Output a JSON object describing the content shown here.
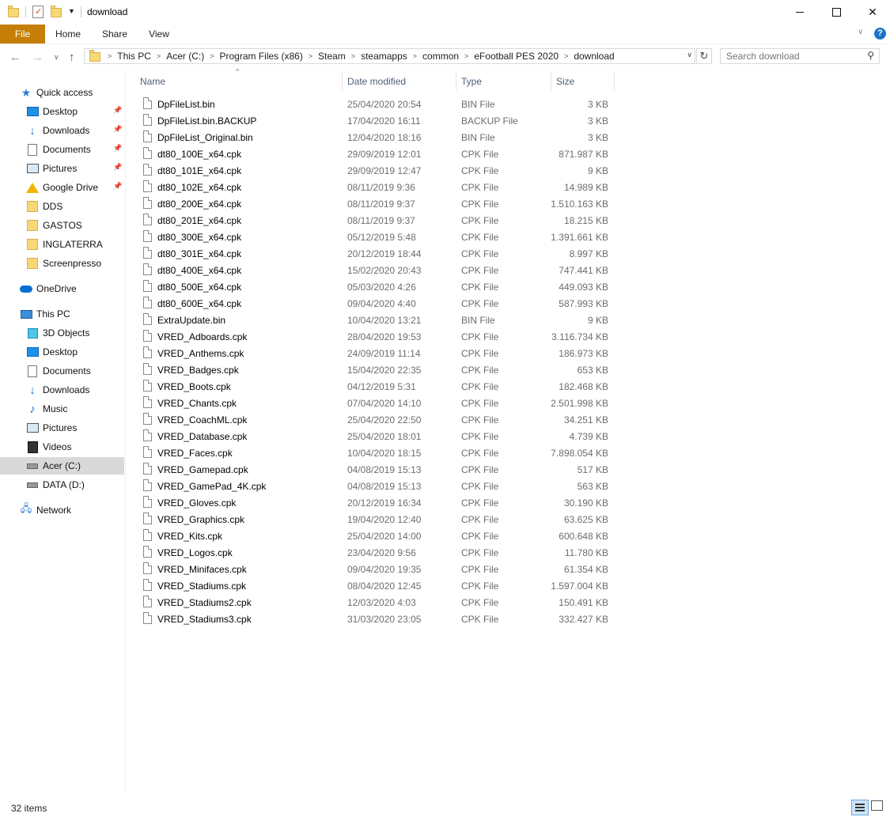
{
  "window": {
    "title": "download",
    "minimize_icon": "minimize-icon",
    "maximize_icon": "maximize-icon",
    "close_icon": "close-icon"
  },
  "ribbon": {
    "tabs": [
      "File",
      "Home",
      "Share",
      "View"
    ],
    "file_tab_color": "#c57e07",
    "help_label": "?"
  },
  "address": {
    "breadcrumbs": [
      "This PC",
      "Acer (C:)",
      "Program Files (x86)",
      "Steam",
      "steamapps",
      "common",
      "eFootball PES 2020",
      "download"
    ]
  },
  "search": {
    "placeholder": "Search download"
  },
  "sidebar": {
    "items": [
      {
        "label": "Quick access",
        "icon": "star-icon",
        "pinned": false,
        "indent": 0
      },
      {
        "label": "Desktop",
        "icon": "desktop-icon",
        "pinned": true,
        "indent": 1
      },
      {
        "label": "Downloads",
        "icon": "downloads-icon",
        "pinned": true,
        "indent": 1
      },
      {
        "label": "Documents",
        "icon": "documents-icon",
        "pinned": true,
        "indent": 1
      },
      {
        "label": "Pictures",
        "icon": "pictures-icon",
        "pinned": true,
        "indent": 1
      },
      {
        "label": "Google Drive",
        "icon": "google-drive-icon",
        "pinned": true,
        "indent": 1
      },
      {
        "label": "DDS",
        "icon": "folder-icon",
        "pinned": false,
        "indent": 1
      },
      {
        "label": "GASTOS",
        "icon": "folder-icon",
        "pinned": false,
        "indent": 1
      },
      {
        "label": "INGLATERRA",
        "icon": "folder-icon",
        "pinned": false,
        "indent": 1
      },
      {
        "label": "Screenpresso",
        "icon": "folder-icon",
        "pinned": false,
        "indent": 1
      },
      {
        "label": "OneDrive",
        "icon": "onedrive-icon",
        "pinned": false,
        "indent": 0
      },
      {
        "label": "This PC",
        "icon": "this-pc-icon",
        "pinned": false,
        "indent": 0
      },
      {
        "label": "3D Objects",
        "icon": "3d-objects-icon",
        "pinned": false,
        "indent": 1
      },
      {
        "label": "Desktop",
        "icon": "desktop-icon",
        "pinned": false,
        "indent": 1
      },
      {
        "label": "Documents",
        "icon": "documents-icon",
        "pinned": false,
        "indent": 1
      },
      {
        "label": "Downloads",
        "icon": "downloads-icon",
        "pinned": false,
        "indent": 1
      },
      {
        "label": "Music",
        "icon": "music-icon",
        "pinned": false,
        "indent": 1
      },
      {
        "label": "Pictures",
        "icon": "pictures-icon",
        "pinned": false,
        "indent": 1
      },
      {
        "label": "Videos",
        "icon": "videos-icon",
        "pinned": false,
        "indent": 1
      },
      {
        "label": "Acer (C:)",
        "icon": "drive-c-icon",
        "pinned": false,
        "indent": 1,
        "selected": true
      },
      {
        "label": "DATA (D:)",
        "icon": "drive-d-icon",
        "pinned": false,
        "indent": 1
      },
      {
        "label": "Network",
        "icon": "network-icon",
        "pinned": false,
        "indent": 0
      }
    ]
  },
  "columns": [
    "Name",
    "Date modified",
    "Type",
    "Size"
  ],
  "files": [
    {
      "name": "DpFileList.bin",
      "date": "25/04/2020 20:54",
      "type": "BIN File",
      "size": "3 KB"
    },
    {
      "name": "DpFileList.bin.BACKUP",
      "date": "17/04/2020 16:11",
      "type": "BACKUP File",
      "size": "3 KB"
    },
    {
      "name": "DpFileList_Original.bin",
      "date": "12/04/2020 18:16",
      "type": "BIN File",
      "size": "3 KB"
    },
    {
      "name": "dt80_100E_x64.cpk",
      "date": "29/09/2019 12:01",
      "type": "CPK File",
      "size": "871.987 KB"
    },
    {
      "name": "dt80_101E_x64.cpk",
      "date": "29/09/2019 12:47",
      "type": "CPK File",
      "size": "9 KB"
    },
    {
      "name": "dt80_102E_x64.cpk",
      "date": "08/11/2019 9:36",
      "type": "CPK File",
      "size": "14.989 KB"
    },
    {
      "name": "dt80_200E_x64.cpk",
      "date": "08/11/2019 9:37",
      "type": "CPK File",
      "size": "1.510.163 KB"
    },
    {
      "name": "dt80_201E_x64.cpk",
      "date": "08/11/2019 9:37",
      "type": "CPK File",
      "size": "18.215 KB"
    },
    {
      "name": "dt80_300E_x64.cpk",
      "date": "05/12/2019 5:48",
      "type": "CPK File",
      "size": "1.391.661 KB"
    },
    {
      "name": "dt80_301E_x64.cpk",
      "date": "20/12/2019 18:44",
      "type": "CPK File",
      "size": "8.997 KB"
    },
    {
      "name": "dt80_400E_x64.cpk",
      "date": "15/02/2020 20:43",
      "type": "CPK File",
      "size": "747.441 KB"
    },
    {
      "name": "dt80_500E_x64.cpk",
      "date": "05/03/2020 4:26",
      "type": "CPK File",
      "size": "449.093 KB"
    },
    {
      "name": "dt80_600E_x64.cpk",
      "date": "09/04/2020 4:40",
      "type": "CPK File",
      "size": "587.993 KB"
    },
    {
      "name": "ExtraUpdate.bin",
      "date": "10/04/2020 13:21",
      "type": "BIN File",
      "size": "9 KB"
    },
    {
      "name": "VRED_Adboards.cpk",
      "date": "28/04/2020 19:53",
      "type": "CPK File",
      "size": "3.116.734 KB"
    },
    {
      "name": "VRED_Anthems.cpk",
      "date": "24/09/2019 11:14",
      "type": "CPK File",
      "size": "186.973 KB"
    },
    {
      "name": "VRED_Badges.cpk",
      "date": "15/04/2020 22:35",
      "type": "CPK File",
      "size": "653 KB"
    },
    {
      "name": "VRED_Boots.cpk",
      "date": "04/12/2019 5:31",
      "type": "CPK File",
      "size": "182.468 KB"
    },
    {
      "name": "VRED_Chants.cpk",
      "date": "07/04/2020 14:10",
      "type": "CPK File",
      "size": "2.501.998 KB"
    },
    {
      "name": "VRED_CoachML.cpk",
      "date": "25/04/2020 22:50",
      "type": "CPK File",
      "size": "34.251 KB"
    },
    {
      "name": "VRED_Database.cpk",
      "date": "25/04/2020 18:01",
      "type": "CPK File",
      "size": "4.739 KB"
    },
    {
      "name": "VRED_Faces.cpk",
      "date": "10/04/2020 18:15",
      "type": "CPK File",
      "size": "7.898.054 KB"
    },
    {
      "name": "VRED_Gamepad.cpk",
      "date": "04/08/2019 15:13",
      "type": "CPK File",
      "size": "517 KB"
    },
    {
      "name": "VRED_GamePad_4K.cpk",
      "date": "04/08/2019 15:13",
      "type": "CPK File",
      "size": "563 KB"
    },
    {
      "name": "VRED_Gloves.cpk",
      "date": "20/12/2019 16:34",
      "type": "CPK File",
      "size": "30.190 KB"
    },
    {
      "name": "VRED_Graphics.cpk",
      "date": "19/04/2020 12:40",
      "type": "CPK File",
      "size": "63.625 KB"
    },
    {
      "name": "VRED_Kits.cpk",
      "date": "25/04/2020 14:00",
      "type": "CPK File",
      "size": "600.648 KB"
    },
    {
      "name": "VRED_Logos.cpk",
      "date": "23/04/2020 9:56",
      "type": "CPK File",
      "size": "11.780 KB"
    },
    {
      "name": "VRED_Minifaces.cpk",
      "date": "09/04/2020 19:35",
      "type": "CPK File",
      "size": "61.354 KB"
    },
    {
      "name": "VRED_Stadiums.cpk",
      "date": "08/04/2020 12:45",
      "type": "CPK File",
      "size": "1.597.004 KB"
    },
    {
      "name": "VRED_Stadiums2.cpk",
      "date": "12/03/2020 4:03",
      "type": "CPK File",
      "size": "150.491 KB"
    },
    {
      "name": "VRED_Stadiums3.cpk",
      "date": "31/03/2020 23:05",
      "type": "CPK File",
      "size": "332.427 KB"
    }
  ],
  "status": {
    "item_count": "32 items"
  }
}
